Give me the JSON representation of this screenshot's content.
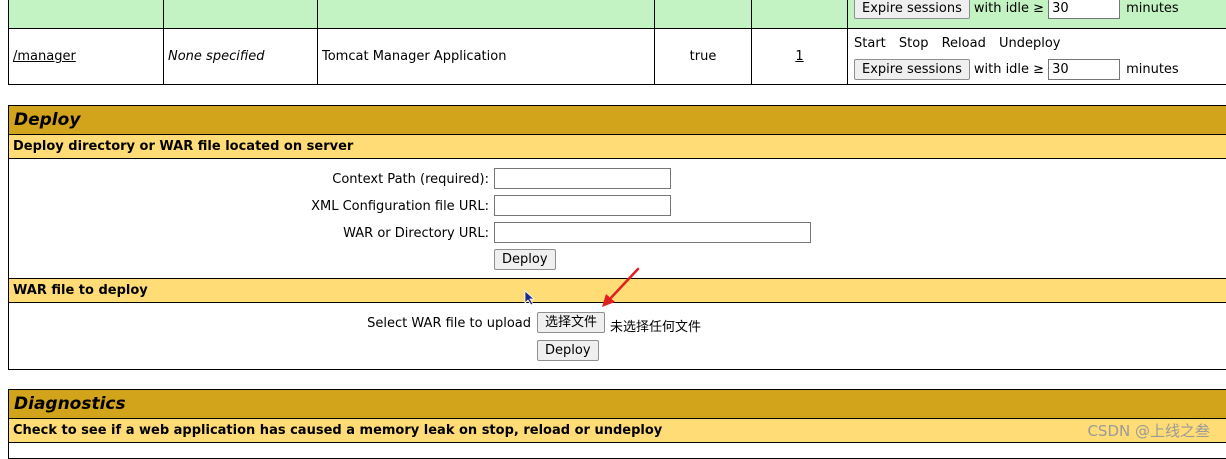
{
  "applications": {
    "rows": [
      {
        "path": "",
        "display_name": "",
        "description": "",
        "running": "",
        "sessions": "",
        "expire_label": "Expire sessions",
        "idle_label": "with idle ≥",
        "idle_value": "30",
        "minutes_label": "minutes"
      },
      {
        "path": "/manager",
        "display_name": "None specified",
        "description": "Tomcat Manager Application",
        "running": "true",
        "sessions": "1",
        "commands": {
          "start": "Start",
          "stop": "Stop",
          "reload": "Reload",
          "undeploy": "Undeploy"
        },
        "expire_label": "Expire sessions",
        "idle_label": "with idle ≥",
        "idle_value": "30",
        "minutes_label": "minutes"
      }
    ]
  },
  "deploy": {
    "title": "Deploy",
    "server_subtitle": "Deploy directory or WAR file located on server",
    "context_path_label": "Context Path (required):",
    "xml_config_label": "XML Configuration file URL:",
    "war_dir_label": "WAR or Directory URL:",
    "deploy_button": "Deploy",
    "war_subtitle": "WAR file to deploy",
    "select_war_label": "Select WAR file to upload",
    "choose_file_button": "选择文件",
    "no_file_text": "未选择任何文件",
    "upload_deploy_button": "Deploy"
  },
  "diagnostics": {
    "title": "Diagnostics",
    "subtitle": "Check to see if a web application has caused a memory leak on stop, reload or undeploy"
  },
  "watermark": "CSDN @上线之叁",
  "colors": {
    "row_green": "#c3f3c3",
    "section_header": "#d2a41c",
    "subheader": "#ffdc75",
    "annotation_arrow": "#e02020",
    "cursor": "#1a2a8a"
  }
}
